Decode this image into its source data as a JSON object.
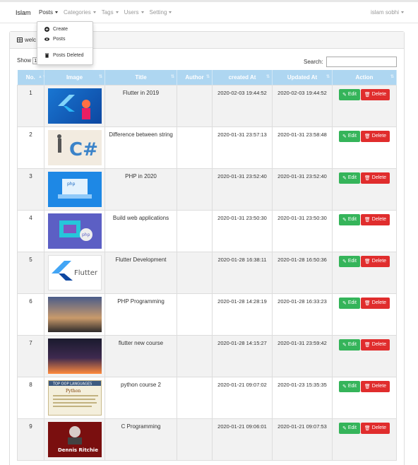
{
  "navbar": {
    "brand": "Islam",
    "items": [
      {
        "label": "Posts",
        "active": true
      },
      {
        "label": "Categories",
        "active": false
      },
      {
        "label": "Tags",
        "active": false
      },
      {
        "label": "Users",
        "active": false
      },
      {
        "label": "Setting",
        "active": false
      }
    ],
    "user": "islam sobhi"
  },
  "dropdown": {
    "items": [
      {
        "label": "Create",
        "icon": "plus-circle-icon"
      },
      {
        "label": "Posts",
        "icon": "eye-icon"
      },
      {
        "label": "Posts Deleted",
        "icon": "trash-icon"
      }
    ]
  },
  "panel": {
    "heading": "welc",
    "show_label": "Show",
    "show_value": "1",
    "search_label": "Search:"
  },
  "table": {
    "columns": [
      "No.",
      "Image",
      "Title",
      "Author",
      "created At",
      "Updated At",
      "Action"
    ],
    "edit_label": "Edit",
    "delete_label": "Delete",
    "rows": [
      {
        "no": "1",
        "title": "Flutter in 2019",
        "author": "",
        "created": "2020-02-03 19:44:52",
        "updated": "2020-02-03 19:44:52",
        "image": "flutter-logo-blue"
      },
      {
        "no": "2",
        "title": "Difference between string",
        "author": "",
        "created": "2020-01-31 23:57:13",
        "updated": "2020-01-31 23:58:48",
        "image": "csharp-sketch"
      },
      {
        "no": "3",
        "title": "PHP in 2020",
        "author": "",
        "created": "2020-01-31 23:52:40",
        "updated": "2020-01-31 23:52:40",
        "image": "php-laptop-blue"
      },
      {
        "no": "4",
        "title": "Build web applications",
        "author": "",
        "created": "2020-01-31 23:50:30",
        "updated": "2020-01-31 23:50:30",
        "image": "php-web-purple"
      },
      {
        "no": "5",
        "title": "Flutter Development",
        "author": "",
        "created": "2020-01-28 16:38:11",
        "updated": "2020-01-28 16:50:36",
        "image": "flutter-logo-white"
      },
      {
        "no": "6",
        "title": "PHP Programming",
        "author": "",
        "created": "2020-01-28 14:28:19",
        "updated": "2020-01-28 16:33:23",
        "image": "city-sunset"
      },
      {
        "no": "7",
        "title": "flutter new course",
        "author": "",
        "created": "2020-01-28 14:15:27",
        "updated": "2020-01-31 23:59:42",
        "image": "robots-dark"
      },
      {
        "no": "8",
        "title": "python course 2",
        "author": "",
        "created": "2020-01-21 09:07:02",
        "updated": "2020-01-23 15:35:35",
        "image": "python-text"
      },
      {
        "no": "9",
        "title": "C Programming",
        "author": "",
        "created": "2020-01-21 09:06:01",
        "updated": "2020-01-21 09:07:53",
        "image": "dennis-ritchie"
      }
    ]
  },
  "image_texts": {
    "flutter_word": "Flutter",
    "php_word": "php",
    "csharp_word": "C#",
    "python_banner": "TOP OOP LANGUAGES",
    "python_word": "Python",
    "dennis_name": "Dennis Ritchie"
  },
  "colors": {
    "header_blue": "#aed6f1",
    "edit_green": "#35b45a",
    "delete_red": "#e02d2d"
  }
}
